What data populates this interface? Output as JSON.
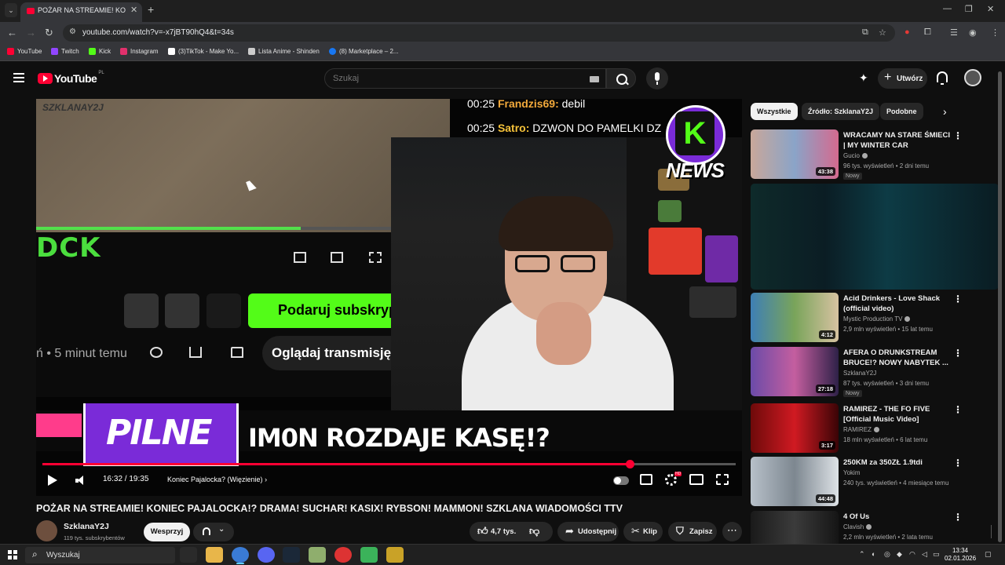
{
  "browser": {
    "tab_title": "POŻAR NA STREAMIE! KONIEC",
    "url": "youtube.com/watch?v=-x7jBT90hQ4&t=34s",
    "bookmarks": [
      {
        "label": "YouTube",
        "color": "#ff0033"
      },
      {
        "label": "Twitch",
        "color": "#9146ff"
      },
      {
        "label": "Kick",
        "color": "#53fc18"
      },
      {
        "label": "Instagram",
        "color": "#e1306c"
      },
      {
        "label": "(3)TikTok - Make Yo...",
        "color": "#ffffff"
      },
      {
        "label": "Lista Anime - Shinden",
        "color": "#cccccc"
      },
      {
        "label": "(8) Marketplace – 2...",
        "color": "#1877f2"
      }
    ]
  },
  "yt": {
    "logo_text": "YouTube",
    "country": "PL",
    "search_placeholder": "Szukaj",
    "create_label": "Utwórz"
  },
  "player": {
    "watermark": "SZKLANAY2J",
    "kick_logo": "DCK",
    "gift_label": "Podaruj subskryp",
    "meta_line": "ń • 5 minut temu",
    "watch_label": "Oglądaj transmisję",
    "chat": [
      {
        "time": "00:25",
        "user": "Frandzis69:",
        "msg": "debil"
      },
      {
        "time": "00:25",
        "user": "Satro:",
        "msg": "DZWON DO PAMELKI DZ"
      }
    ],
    "news_letter": "K",
    "news_label": "NEWS",
    "pilne": "PILNE",
    "headline": "IM0N ROZDAJE KASĘ!?",
    "time": "16:32 / 19:35",
    "chapter": "Koniec Pajalocka? (Więzienie)",
    "progress_fraction": 0.847
  },
  "video": {
    "title": "POŻAR NA STREAMIE! KONIEC PAJALOCKA!? DRAMA! SUCHAR! KASIX! RYBSON! MAMMON! SZKLANA WIADOMOŚCI TTV",
    "channel": "SzklanaY2J",
    "subscribers": "119 tys. subskrybentów",
    "support_label": "Wesprzyj",
    "likes": "4,7 tys.",
    "share_label": "Udostępnij",
    "clip_label": "Klip",
    "save_label": "Zapisz"
  },
  "sidebar": {
    "chips": [
      "Wszystkie",
      "Źródło: SzklanaY2J",
      "Podobne"
    ],
    "recommendations": [
      {
        "title": "WRACAMY NA STARE ŚMIECI | MY WINTER CAR",
        "channel": "Gucio",
        "meta": "96 tys. wyświetleń • 2 dni temu",
        "duration": "43:38",
        "badge": "Nowy"
      },
      {
        "title": "",
        "channel": "",
        "meta": "",
        "duration": "",
        "badge": ""
      },
      {
        "title": "Acid Drinkers - Love Shack (official video)",
        "channel": "Mystic Production TV",
        "meta": "2,9 mln wyświetleń • 15 lat temu",
        "duration": "4:12",
        "badge": ""
      },
      {
        "title": "AFERA O DRUNKSTREAM BRUCE!? NOWY NABYTEK ...",
        "channel": "SzklanaY2J",
        "meta": "87 tys. wyświetleń • 3 dni temu",
        "duration": "27:18",
        "badge": "Nowy"
      },
      {
        "title": "RAMIREZ - THE FO FIVE [Official Music Video]",
        "channel": "RAMIREZ",
        "meta": "18 mln wyświetleń • 6 lat temu",
        "duration": "3:17",
        "badge": ""
      },
      {
        "title": "250KM za 350ZŁ 1.9tdi",
        "channel": "Yokim",
        "meta": "240 tys. wyświetleń • 4 miesiące temu",
        "duration": "44:48",
        "badge": ""
      },
      {
        "title": "4 Of Us",
        "channel": "Clavish",
        "meta": "2,2 mln wyświetleń • 2 lata temu",
        "duration": "",
        "badge": ""
      }
    ]
  },
  "taskbar": {
    "search": "Wyszukaj",
    "time": "13:34",
    "date": "02.01.2026"
  }
}
